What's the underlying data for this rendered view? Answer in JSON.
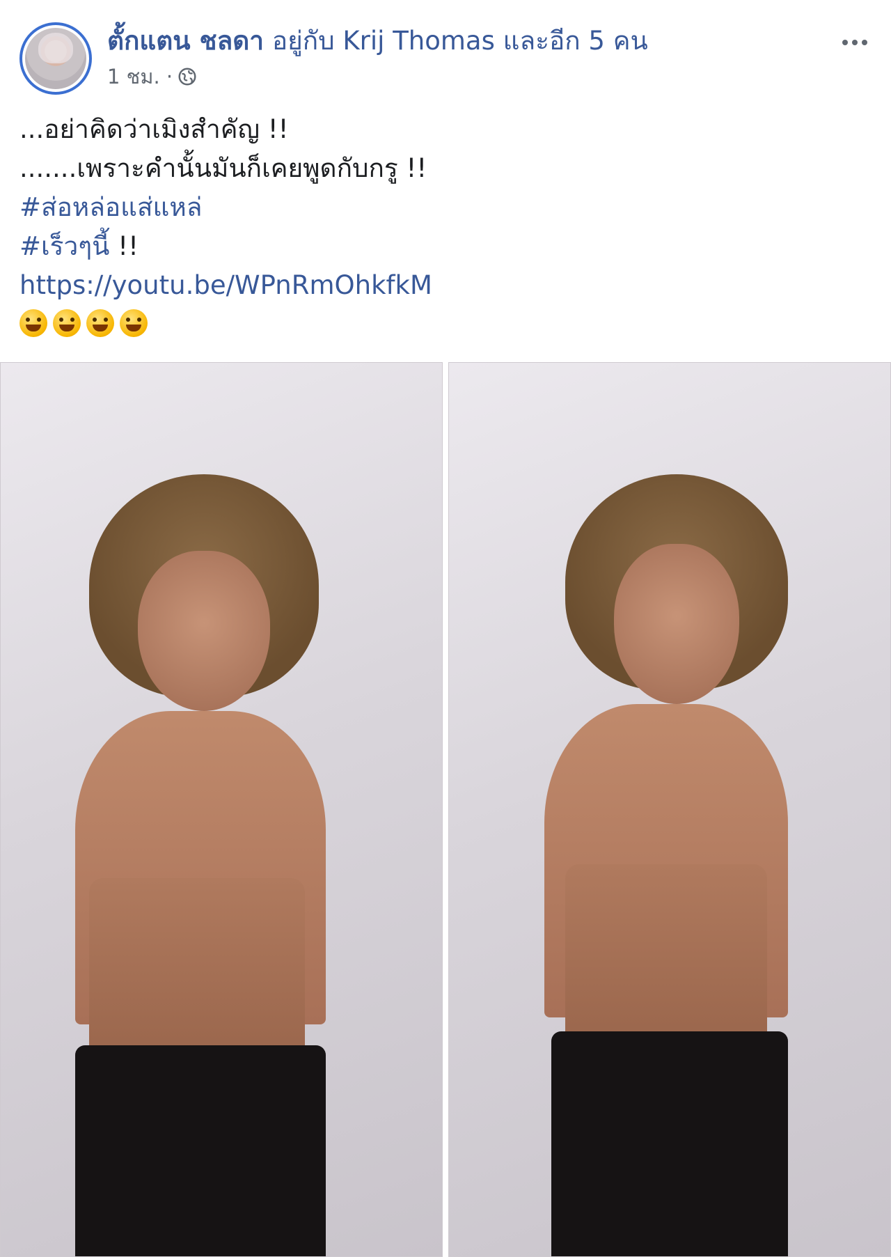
{
  "post": {
    "author_name": "ตั้กแตน ชลดา",
    "with_text": "อยู่กับ Krij Thomas และอีก 5 คน",
    "timestamp": "1 ชม. ·",
    "privacy_icon": "globe-icon",
    "more_icon": "more-options-icon",
    "caption": {
      "line1": "...อย่าคิดว่าเมิงสำคัญ !!",
      "line2": ".......เพราะคำนั้นมันก็เคยพูดกับกรู !!",
      "hashtag1": "#ส่อหล่อแส่แหล่",
      "hashtag2": "#เร็วๆนี้",
      "hashtag2_suffix": " !!",
      "link": "https://youtu.be/WPnRmOhkfkM"
    },
    "emojis": [
      "grinning-face-emoji",
      "relieved-face-emoji",
      "rolling-laughing-emoji",
      "tears-of-joy-emoji"
    ]
  },
  "colors": {
    "link_blue": "#385898",
    "text_primary": "#1c1e21",
    "text_secondary": "#606770",
    "avatar_ring": "#3b6fd1"
  }
}
